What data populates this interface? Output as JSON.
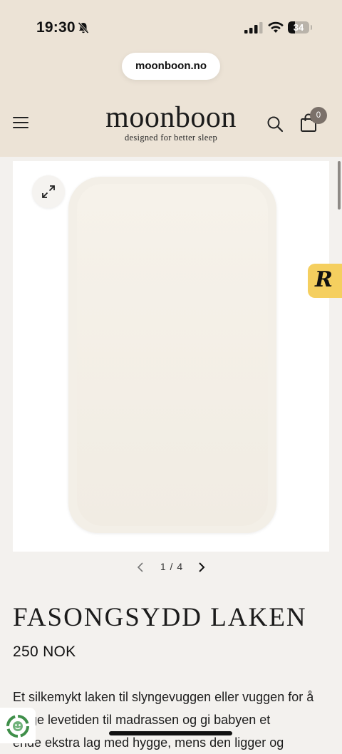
{
  "status_bar": {
    "time": "19:30",
    "battery_percent": "34",
    "icons": [
      "bell-slash-icon",
      "signal-icon",
      "wifi-icon",
      "battery-icon"
    ]
  },
  "browser": {
    "url": "moonboon.no"
  },
  "header": {
    "logo_name": "moonboon",
    "logo_tagline": "designed for better sleep",
    "cart_count": "0",
    "icons": [
      "menu-icon",
      "search-icon",
      "bag-icon"
    ]
  },
  "gallery": {
    "current": "1",
    "separator": "/",
    "total": "4",
    "image_color": "#f3efe7",
    "icons": [
      "expand-icon",
      "chevron-left-icon",
      "chevron-right-icon"
    ]
  },
  "product": {
    "title": "FASONGSYDD LAKEN",
    "price": "250 NOK",
    "description_lines": [
      "Et silkemykt laken til slyngevuggen eller vuggen for å",
      "  lenge levetiden til madrassen og gi babyen et",
      "  ende ekstra lag med hygge, mens den ligger og"
    ]
  },
  "widgets": {
    "reviews_badge": "R",
    "reviews_color": "#f5cf5f",
    "recycle_icon": "recycle-icon"
  },
  "colors": {
    "header_bg": "#ece3d6",
    "page_bg": "#f3f1ee",
    "badge_bg": "#7b716a"
  }
}
